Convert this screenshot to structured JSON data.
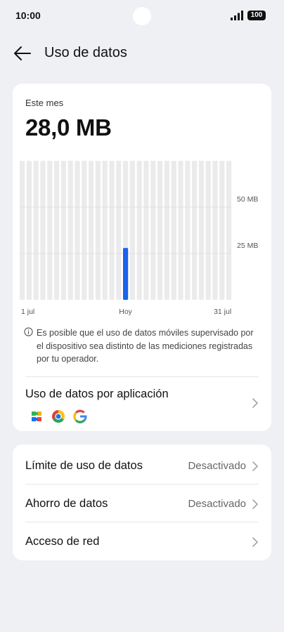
{
  "status_bar": {
    "time": "10:00",
    "battery": "100"
  },
  "header": {
    "title": "Uso de datos",
    "back_icon": "arrow-left-icon"
  },
  "usage": {
    "period_label": "Este mes",
    "total": "28,0 MB"
  },
  "chart_data": {
    "type": "bar",
    "x_tick_labels": [
      "1 jul",
      "Hoy",
      "31 jul"
    ],
    "y_tick_labels": [
      "50 MB",
      "25 MB"
    ],
    "y_ticks": [
      50,
      25
    ],
    "ylim": [
      0,
      75
    ],
    "unit": "MB",
    "categories": [
      "1",
      "2",
      "3",
      "4",
      "5",
      "6",
      "7",
      "8",
      "9",
      "10",
      "11",
      "12",
      "13",
      "14",
      "15",
      "16",
      "17",
      "18",
      "19",
      "20",
      "21",
      "22",
      "23",
      "24",
      "25",
      "26",
      "27",
      "28",
      "29",
      "30",
      "31"
    ],
    "values": [
      0,
      0,
      0,
      0,
      0,
      0,
      0,
      0,
      0,
      0,
      0,
      0,
      0,
      0,
      0,
      28,
      0,
      0,
      0,
      0,
      0,
      0,
      0,
      0,
      0,
      0,
      0,
      0,
      0,
      0,
      0
    ],
    "highlight_index": 15,
    "colors": {
      "track": "#ebebeb",
      "bar": "#1a63ed",
      "grid": "#dcdcdc"
    }
  },
  "info": {
    "icon": "info-icon",
    "text": "Es posible que el uso de datos móviles supervisado por el dispositivo sea distinto de las mediciones registradas por tu operador."
  },
  "app_usage": {
    "title": "Uso de datos por aplicación",
    "icons": [
      "puzzle-app-icon",
      "chrome-icon",
      "google-icon"
    ]
  },
  "settings": [
    {
      "label": "Límite de uso de datos",
      "value": "Desactivado"
    },
    {
      "label": "Ahorro de datos",
      "value": "Desactivado"
    },
    {
      "label": "Acceso de red",
      "value": ""
    }
  ],
  "colors": {
    "accent": "#1a63ed",
    "background": "#eff0f4",
    "card": "#ffffff"
  }
}
